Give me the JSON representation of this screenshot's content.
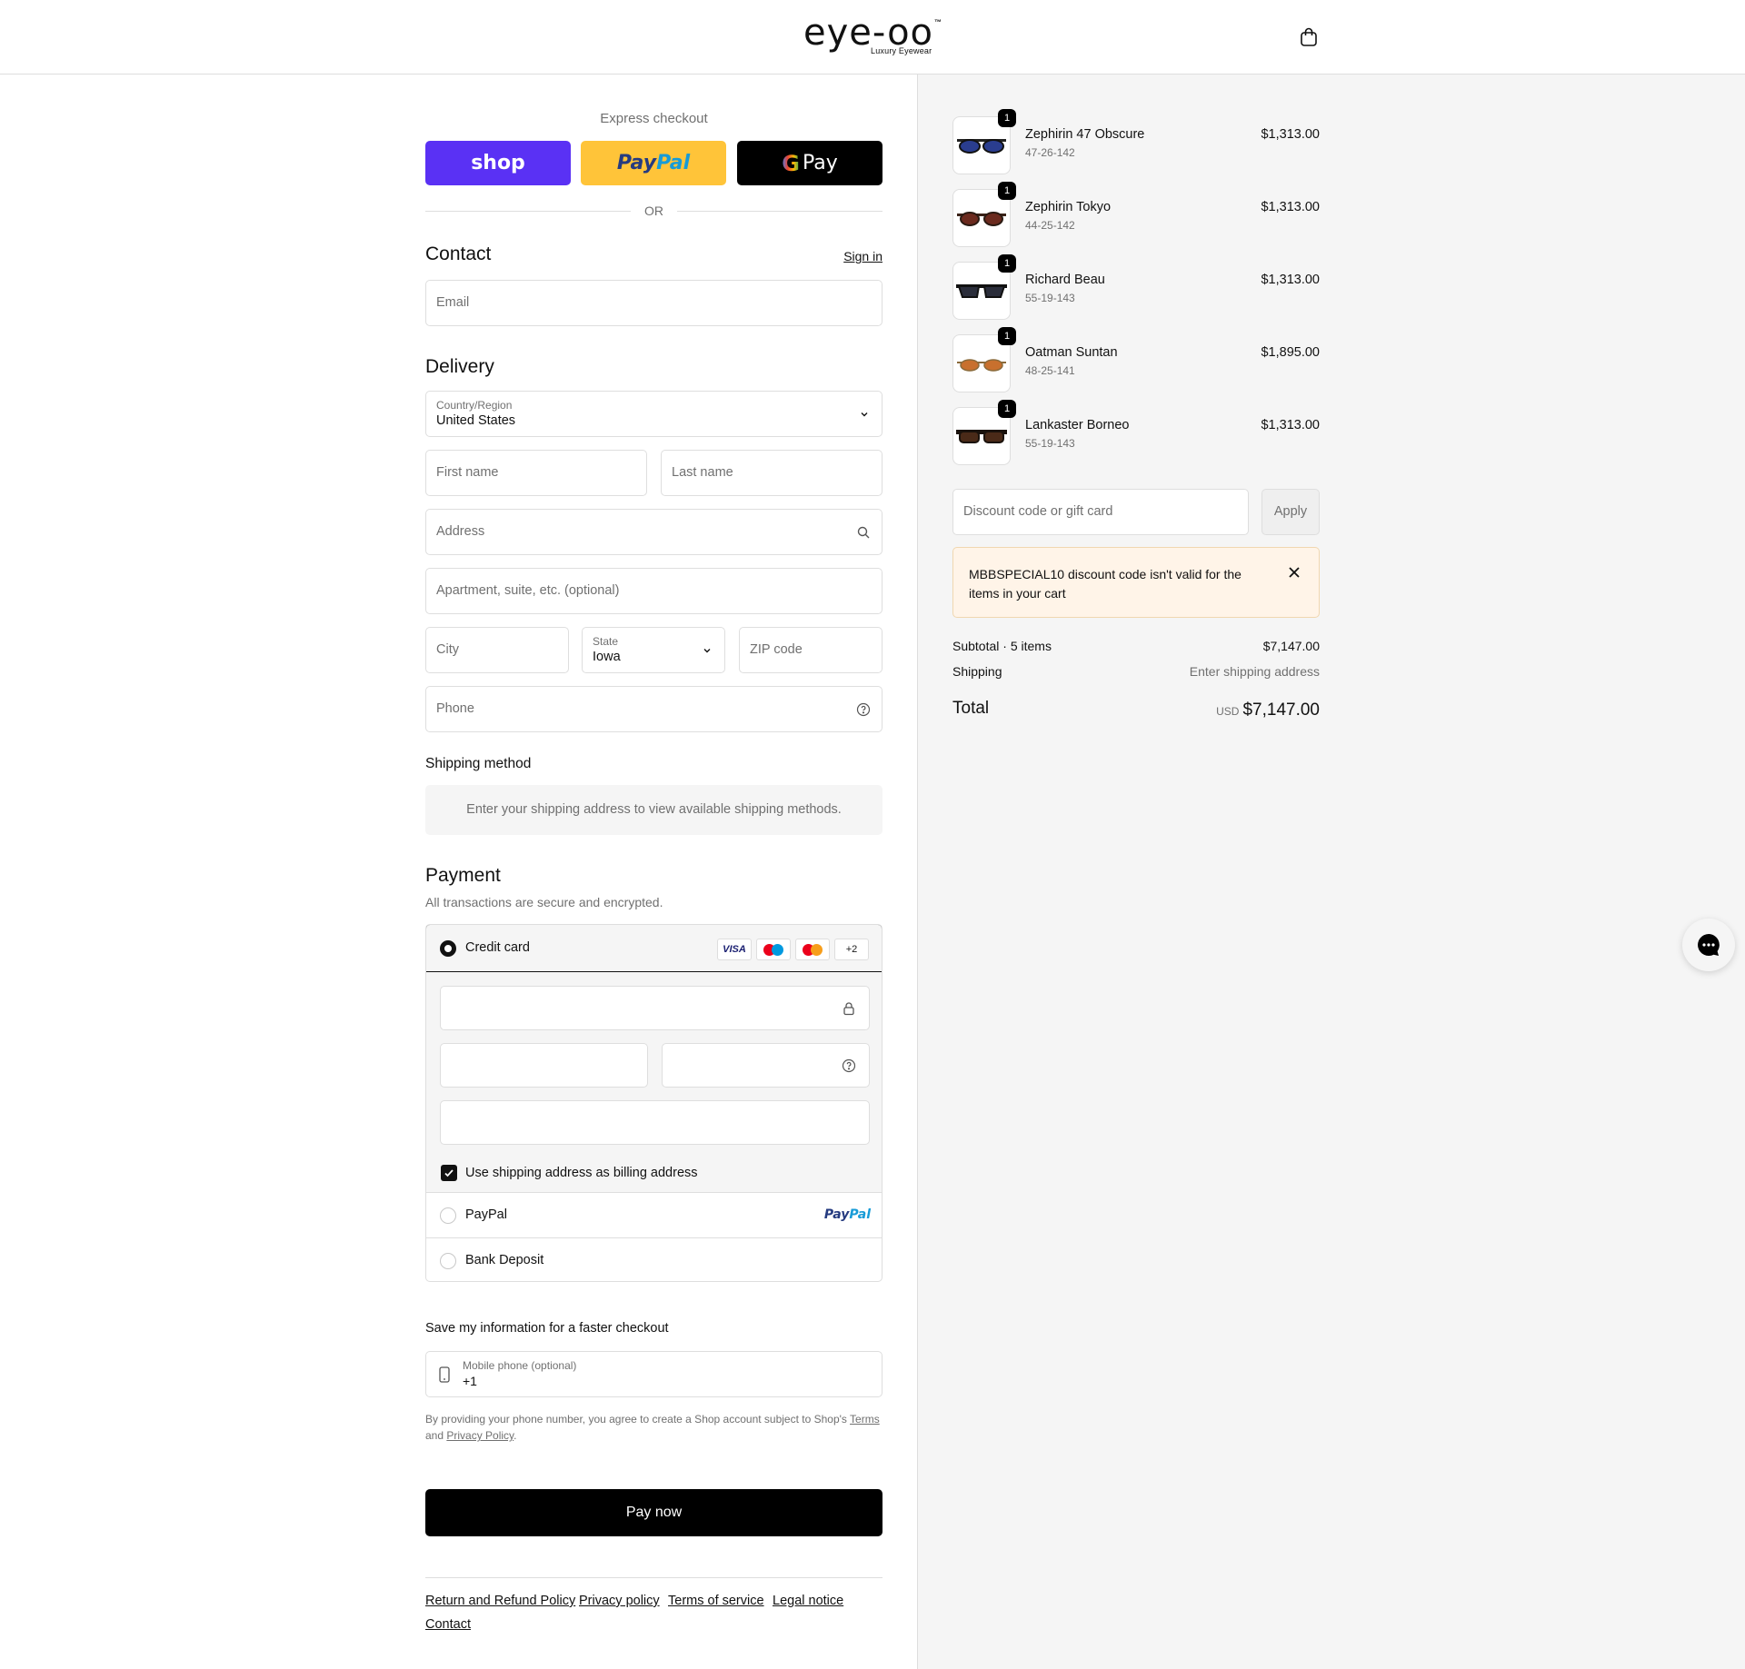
{
  "header": {
    "logo_text": "eye-oo",
    "logo_tm": "™",
    "logo_tagline": "Luxury Eyewear"
  },
  "express": {
    "title": "Express checkout",
    "shop_label": "shop",
    "paypal_label_1": "Pay",
    "paypal_label_2": "Pal",
    "gpay_label": "Pay",
    "or_label": "OR"
  },
  "contact": {
    "title": "Contact",
    "signin": "Sign in",
    "email_placeholder": "Email"
  },
  "delivery": {
    "title": "Delivery",
    "country_label": "Country/Region",
    "country_value": "United States",
    "first_name": "First name",
    "last_name": "Last name",
    "address": "Address",
    "apartment": "Apartment, suite, etc. (optional)",
    "city": "City",
    "state_label": "State",
    "state_value": "Iowa",
    "zip": "ZIP code",
    "phone": "Phone"
  },
  "shipping": {
    "title": "Shipping method",
    "message": "Enter your shipping address to view available shipping methods."
  },
  "payment": {
    "title": "Payment",
    "subtitle": "All transactions are secure and encrypted.",
    "credit_card": "Credit card",
    "visa": "VISA",
    "more_cards": "+2",
    "billing_checkbox": "Use shipping address as billing address",
    "paypal": "PayPal",
    "paypal_logo_1": "Pay",
    "paypal_logo_2": "Pal",
    "bank": "Bank Deposit"
  },
  "save": {
    "title": "Save my information for a faster checkout",
    "mobile_label": "Mobile phone (optional)",
    "mobile_value": "+1",
    "legal_1": "By providing your phone number, you agree to create a Shop account subject to Shop's ",
    "legal_terms": "Terms",
    "legal_2": " and ",
    "legal_privacy": "Privacy Policy",
    "legal_3": "."
  },
  "pay_now": "Pay now",
  "footer": {
    "links": [
      "Return and Refund Policy",
      "Privacy policy",
      "Terms of service",
      "Legal notice",
      "Contact"
    ]
  },
  "summary": {
    "items": [
      {
        "name": "Zephirin 47 Obscure",
        "size": "47-26-142",
        "price": "$1,313.00",
        "qty": "1",
        "lens": "#2a3d8f"
      },
      {
        "name": "Zephirin Tokyo",
        "size": "44-25-142",
        "price": "$1,313.00",
        "qty": "1",
        "lens": "#6b2a1e"
      },
      {
        "name": "Richard Beau",
        "size": "55-19-143",
        "price": "$1,313.00",
        "qty": "1",
        "lens": "#2a2d3a"
      },
      {
        "name": "Oatman Suntan",
        "size": "48-25-141",
        "price": "$1,895.00",
        "qty": "1",
        "lens": "#c8702e"
      },
      {
        "name": "Lankaster Borneo",
        "size": "55-19-143",
        "price": "$1,313.00",
        "qty": "1",
        "lens": "#4a2a18"
      }
    ],
    "discount_placeholder": "Discount code or gift card",
    "apply": "Apply",
    "alert": "MBBSPECIAL10 discount code isn't valid for the items in your cart",
    "subtotal_label": "Subtotal · 5 items",
    "subtotal_value": "$7,147.00",
    "shipping_label": "Shipping",
    "shipping_value": "Enter shipping address",
    "total_label": "Total",
    "currency": "USD",
    "total_value": "$7,147.00"
  }
}
